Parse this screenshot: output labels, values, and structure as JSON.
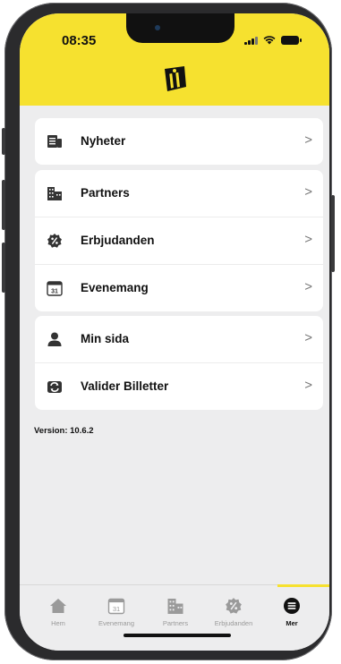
{
  "status_bar": {
    "time": "08:35"
  },
  "menu": {
    "group1": [
      {
        "label": "Nyheter",
        "icon": "news-icon"
      }
    ],
    "group2": [
      {
        "label": "Partners",
        "icon": "building-icon"
      },
      {
        "label": "Erbjudanden",
        "icon": "discount-badge-icon"
      },
      {
        "label": "Evenemang",
        "icon": "calendar-icon",
        "calendar_day": "31"
      }
    ],
    "group3": [
      {
        "label": "Min sida",
        "icon": "person-icon"
      },
      {
        "label": "Valider Billetter",
        "icon": "ticket-sync-icon"
      }
    ],
    "chevron": ">"
  },
  "version": "Version: 10.6.2",
  "tabs": [
    {
      "label": "Hem",
      "icon": "home-icon"
    },
    {
      "label": "Evenemang",
      "icon": "calendar-icon",
      "calendar_day": "31"
    },
    {
      "label": "Partners",
      "icon": "building-icon"
    },
    {
      "label": "Erbjudanden",
      "icon": "discount-badge-icon"
    },
    {
      "label": "Mer",
      "icon": "menu-icon"
    }
  ],
  "colors": {
    "accent": "#f6e12f",
    "background": "#ededee",
    "inactive": "#9a9a9a"
  }
}
